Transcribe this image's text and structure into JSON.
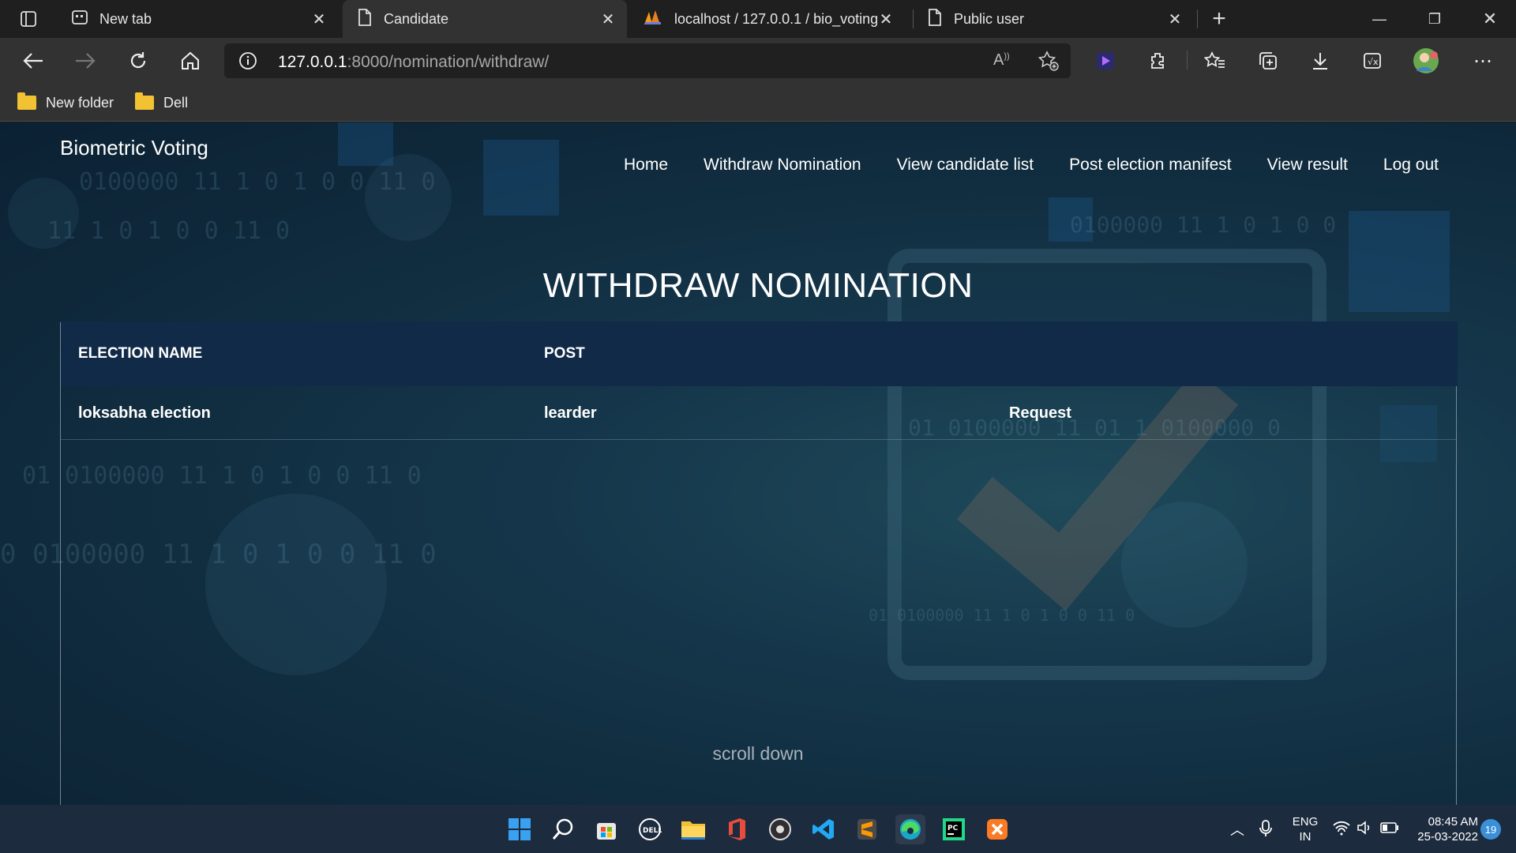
{
  "browser": {
    "tabs": [
      {
        "title": "New tab",
        "icon": "newtab-icon",
        "active": false
      },
      {
        "title": "Candidate",
        "icon": "page-icon",
        "active": true
      },
      {
        "title": "localhost / 127.0.0.1 / bio_voting",
        "icon": "phpmyadmin-icon",
        "active": false
      },
      {
        "title": "Public user",
        "icon": "page-icon",
        "active": false
      }
    ],
    "url_host": "127.0.0.1",
    "url_rest": ":8000/nomination/withdraw/",
    "bookmarks": [
      "New folder",
      "Dell"
    ]
  },
  "site": {
    "brand": "Biometric Voting",
    "nav": [
      "Home",
      "Withdraw Nomination",
      "View candidate list",
      "Post election manifest",
      "View result",
      "Log out"
    ]
  },
  "page": {
    "heading": "WITHDRAW NOMINATION",
    "table": {
      "headers": [
        "ELECTION NAME",
        "POST"
      ],
      "rows": [
        {
          "election": "loksabha election",
          "post": "learder",
          "action": "Request"
        }
      ]
    },
    "scroll_hint": "scroll down"
  },
  "taskbar": {
    "apps": [
      "start-icon",
      "search-icon",
      "store-icon",
      "dell-icon",
      "file-explorer-icon",
      "office-icon",
      "obs-icon",
      "vscode-icon",
      "sublime-icon",
      "edge-icon",
      "pycharm-icon",
      "xampp-icon"
    ],
    "lang": "ENG",
    "region": "IN",
    "time": "08:45 AM",
    "date": "25-03-2022",
    "notifications": "19"
  },
  "colors": {
    "header_row": "#112a48",
    "page_bg": "#15364a"
  }
}
